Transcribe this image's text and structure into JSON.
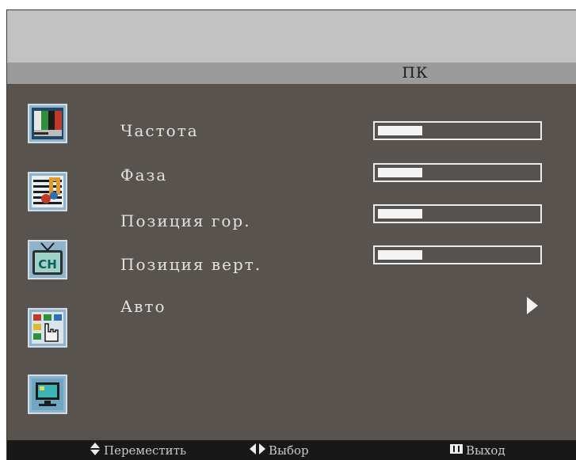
{
  "header": {
    "title": "ПК"
  },
  "sidebar": {
    "icons": [
      {
        "name": "picture-icon"
      },
      {
        "name": "audio-icon"
      },
      {
        "name": "channel-icon"
      },
      {
        "name": "function-icon"
      },
      {
        "name": "pc-icon"
      }
    ]
  },
  "menu": {
    "items": [
      {
        "label": "Частота",
        "value": 0.28
      },
      {
        "label": "Фаза",
        "value": 0.28
      },
      {
        "label": "Позиция гор.",
        "value": 0.28
      },
      {
        "label": "Позиция верт.",
        "value": 0.28
      },
      {
        "label": "Авто"
      }
    ]
  },
  "footer": {
    "move_label": "Переместить",
    "select_label": "Выбор",
    "exit_label": "Выход"
  }
}
